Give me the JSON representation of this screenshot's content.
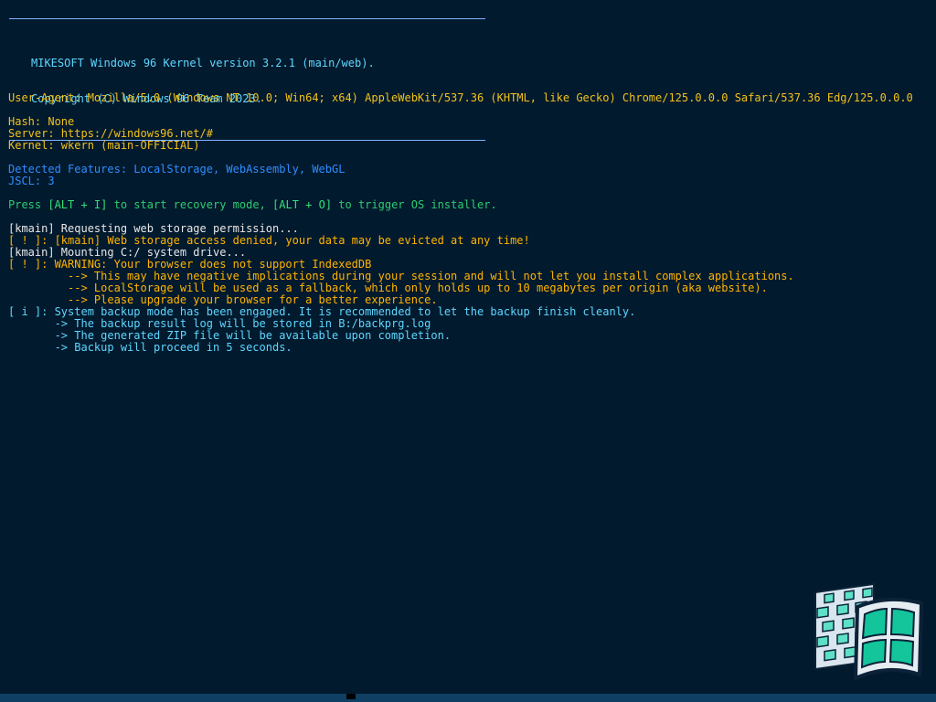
{
  "banner": {
    "line1": "MIKESOFT Windows 96 Kernel version 3.2.1 (main/web).",
    "line2": "Copyright (C) Windows 96 Team 2023."
  },
  "system": {
    "user_agent": "User-Agent: Mozilla/5.0 (Windows NT 10.0; Win64; x64) AppleWebKit/537.36 (KHTML, like Gecko) Chrome/125.0.0.0 Safari/537.36 Edg/125.0.0.0",
    "hash": "Hash: None",
    "server": "Server: https://windows96.net/#",
    "kernel": "Kernel: wkern (main-OFFICIAL)"
  },
  "features": {
    "detected": "Detected Features: LocalStorage, WebAssembly, WebGL",
    "jscl": "JSCL: 3"
  },
  "recovery": {
    "prefix": "Press ",
    "key1": "[ALT + I]",
    "mid": " to start recovery mode, ",
    "key2": "[ALT + O]",
    "suffix": " to trigger OS installer."
  },
  "log": {
    "l1": "[kmain] Requesting web storage permission...",
    "l2": "[ ! ]: [kmain] Web storage access denied, your data may be evicted at any time!",
    "l3": "[kmain] Mounting C:/ system drive...",
    "l4": "[ ! ]: WARNING: Your browser does not support IndexedDB",
    "l5": "         --> This may have negative implications during your session and will not let you install complex applications.",
    "l6": "         --> LocalStorage will be used as a fallback, which only holds up to 10 megabytes per origin (aka website).",
    "l7": "         --> Please upgrade your browser for a better experience.",
    "l8": "[ i ]: System backup mode has been engaged. It is recommended to let the backup finish cleanly.",
    "l9": "       -> The backup result log will be stored in B:/backprg.log",
    "l10": "       -> The generated ZIP file will be available upon completion.",
    "l11": "       -> Backup will proceed in 5 seconds."
  },
  "colors": {
    "background": "#021a2e",
    "banner": "#5fd7ff",
    "info": "#f1c21b",
    "features": "#2f8dff",
    "recovery": "#2ecc71",
    "log_plain": "#e8e8e8",
    "log_warning": "#ffb400",
    "log_info": "#5fd7ff"
  },
  "icons": {
    "logo": "windows96-logo-icon"
  }
}
